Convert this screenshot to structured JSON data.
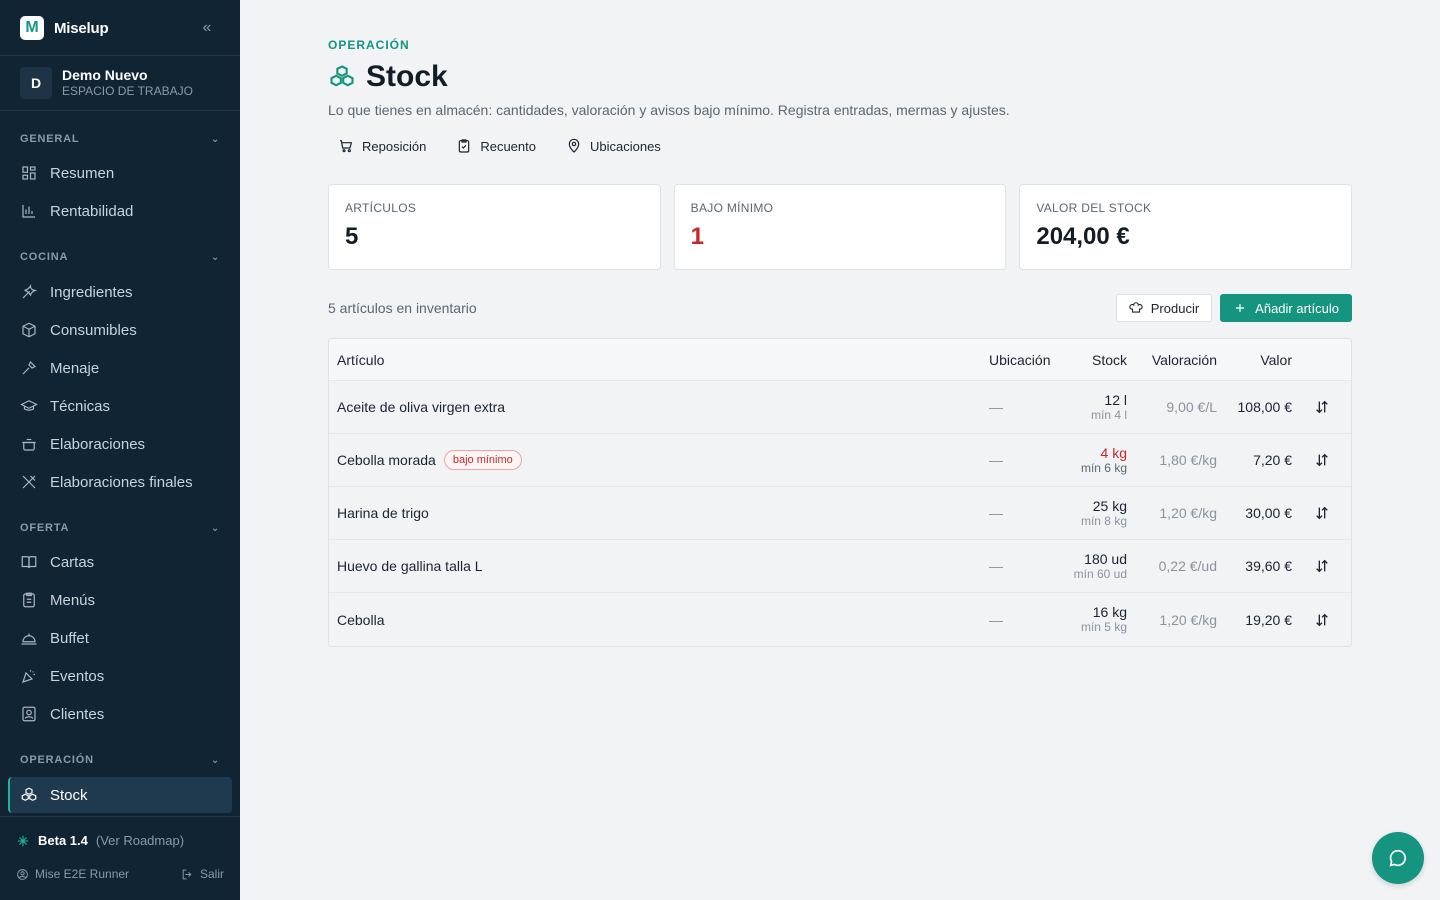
{
  "brand": {
    "logo_letter": "M",
    "name": "Miselup",
    "collapse_glyph": "«"
  },
  "workspace": {
    "initial": "D",
    "name": "Demo Nuevo",
    "subtitle": "ESPACIO DE TRABAJO"
  },
  "sidebar": {
    "sections": [
      {
        "label": "GENERAL",
        "items": [
          {
            "label": "Resumen",
            "icon": "grid-icon"
          },
          {
            "label": "Rentabilidad",
            "icon": "bar-chart-icon"
          }
        ]
      },
      {
        "label": "COCINA",
        "items": [
          {
            "label": "Ingredientes",
            "icon": "carrot-icon"
          },
          {
            "label": "Consumibles",
            "icon": "box-icon"
          },
          {
            "label": "Menaje",
            "icon": "tools-icon"
          },
          {
            "label": "Técnicas",
            "icon": "graduation-cap-icon"
          },
          {
            "label": "Elaboraciones",
            "icon": "pot-icon"
          },
          {
            "label": "Elaboraciones finales",
            "icon": "utensils-icon"
          }
        ]
      },
      {
        "label": "OFERTA",
        "items": [
          {
            "label": "Cartas",
            "icon": "book-icon"
          },
          {
            "label": "Menús",
            "icon": "clipboard-icon"
          },
          {
            "label": "Buffet",
            "icon": "cloche-icon"
          },
          {
            "label": "Eventos",
            "icon": "party-icon"
          },
          {
            "label": "Clientes",
            "icon": "contact-icon"
          }
        ]
      },
      {
        "label": "OPERACIÓN",
        "items": [
          {
            "label": "Stock",
            "icon": "boxes-icon",
            "active": true
          }
        ]
      }
    ],
    "beta": {
      "version": "Beta 1.4",
      "roadmap": "(Ver Roadmap)"
    },
    "user": {
      "name": "Mise E2E Runner",
      "logout": "Salir"
    }
  },
  "header": {
    "eyebrow": "OPERACIÓN",
    "title": "Stock",
    "description": "Lo que tienes en almacén: cantidades, valoración y avisos bajo mínimo. Registra entradas, mermas y ajustes.",
    "quick_links": [
      {
        "label": "Reposición",
        "icon": "cart-icon"
      },
      {
        "label": "Recuento",
        "icon": "clipboard-check-icon"
      },
      {
        "label": "Ubicaciones",
        "icon": "map-pin-icon"
      }
    ]
  },
  "stats": [
    {
      "label": "ARTÍCULOS",
      "value": "5"
    },
    {
      "label": "BAJO MÍNIMO",
      "value": "1"
    },
    {
      "label": "VALOR DEL STOCK",
      "value": "204,00 €"
    }
  ],
  "inventory": {
    "count_label": "5 artículos en inventario",
    "produce_label": "Producir",
    "add_label": "Añadir artículo",
    "columns": [
      "Artículo",
      "Ubicación",
      "Stock",
      "Valoración",
      "Valor"
    ],
    "rows": [
      {
        "name": "Aceite de oliva virgen extra",
        "badge": "",
        "location": "—",
        "stock": "12 l",
        "min": "mín 4 l",
        "valuation": "9,00 €/L",
        "value": "108,00 €",
        "low": false
      },
      {
        "name": "Cebolla morada",
        "badge": "bajo mínimo",
        "location": "—",
        "stock": "4 kg",
        "min": "mín 6 kg",
        "valuation": "1,80 €/kg",
        "value": "7,20 €",
        "low": true
      },
      {
        "name": "Harina de trigo",
        "badge": "",
        "location": "—",
        "stock": "25 kg",
        "min": "mín 8 kg",
        "valuation": "1,20 €/kg",
        "value": "30,00 €",
        "low": false
      },
      {
        "name": "Huevo de gallina talla L",
        "badge": "",
        "location": "—",
        "stock": "180 ud",
        "min": "mín 60 ud",
        "valuation": "0,22 €/ud",
        "value": "39,60 €",
        "low": false
      },
      {
        "name": "Cebolla",
        "badge": "",
        "location": "—",
        "stock": "16 kg",
        "min": "mín 5 kg",
        "valuation": "1,20 €/kg",
        "value": "19,20 €",
        "low": false
      }
    ]
  },
  "colors": {
    "accent": "#15947f",
    "sidebar_bg": "#102434",
    "danger": "#c62828"
  }
}
